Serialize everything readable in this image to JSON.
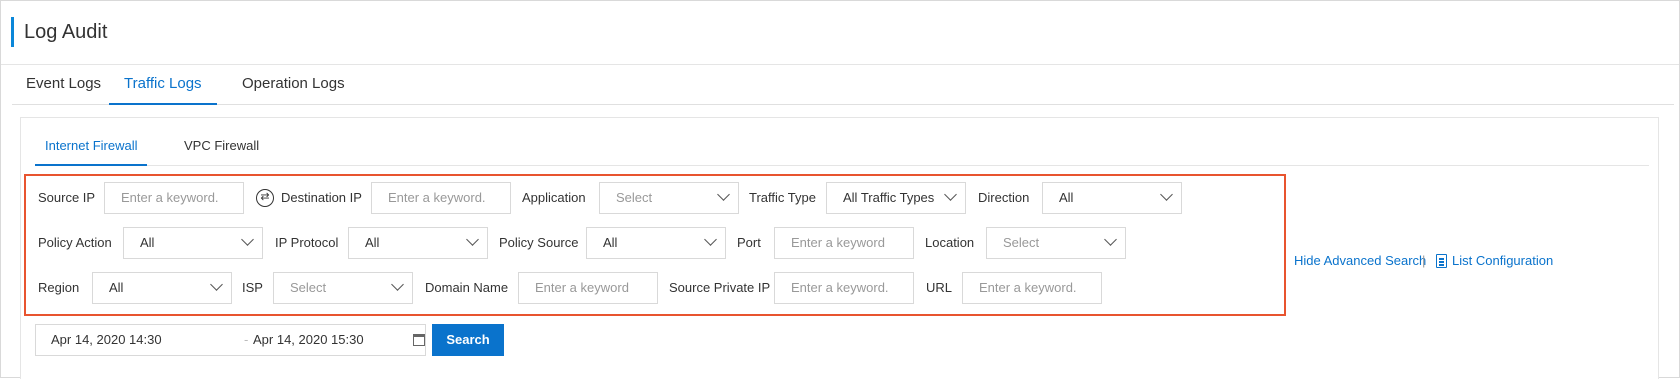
{
  "header": {
    "title": "Log Audit"
  },
  "main_tabs": [
    {
      "label": "Event Logs",
      "active": false
    },
    {
      "label": "Traffic Logs",
      "active": true
    },
    {
      "label": "Operation Logs",
      "active": false
    }
  ],
  "sub_tabs": [
    {
      "label": "Internet Firewall",
      "active": true
    },
    {
      "label": "VPC Firewall",
      "active": false
    }
  ],
  "filters": {
    "source_ip": {
      "label": "Source IP",
      "placeholder": "Enter a keyword."
    },
    "destination_ip": {
      "label": "Destination IP",
      "placeholder": "Enter a keyword."
    },
    "application": {
      "label": "Application",
      "placeholder": "Select"
    },
    "traffic_type": {
      "label": "Traffic Type",
      "value": "All Traffic Types"
    },
    "direction": {
      "label": "Direction",
      "value": "All"
    },
    "policy_action": {
      "label": "Policy Action",
      "value": "All"
    },
    "ip_protocol": {
      "label": "IP Protocol",
      "value": "All"
    },
    "policy_source": {
      "label": "Policy Source",
      "value": "All"
    },
    "port": {
      "label": "Port",
      "placeholder": "Enter a keyword"
    },
    "location": {
      "label": "Location",
      "placeholder": "Select"
    },
    "region": {
      "label": "Region",
      "value": "All"
    },
    "isp": {
      "label": "ISP",
      "placeholder": "Select"
    },
    "domain_name": {
      "label": "Domain Name",
      "placeholder": "Enter a keyword"
    },
    "source_private_ip": {
      "label": "Source Private IP",
      "placeholder": "Enter a keyword."
    },
    "url": {
      "label": "URL",
      "placeholder": "Enter a keyword."
    }
  },
  "date_range": {
    "start": "Apr 14, 2020 14:30",
    "separator": "-",
    "end": "Apr 14, 2020 15:30"
  },
  "actions": {
    "search_label": "Search",
    "hide_advanced_label": "Hide Advanced Search",
    "separator": "|",
    "list_config_label": "List Configuration"
  },
  "colors": {
    "accent": "#0a73cc",
    "highlight_border": "#e8542f"
  },
  "icons": [
    "swap-icon",
    "chevron-down-icon",
    "calendar-icon",
    "list-config-icon"
  ]
}
